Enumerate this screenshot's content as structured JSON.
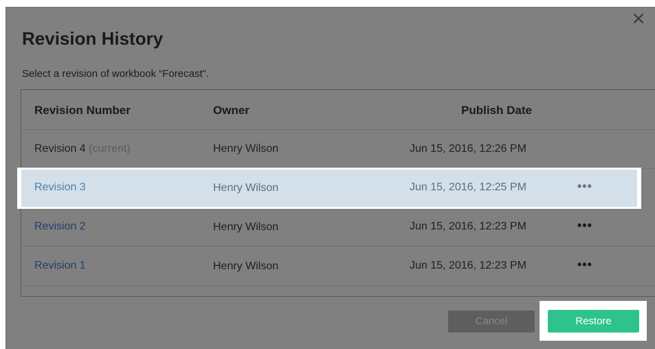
{
  "dialog": {
    "title": "Revision History",
    "subtitle": "Select a revision of workbook “Forecast”.",
    "close_icon": "close-icon",
    "close_glyph": "×"
  },
  "table": {
    "headers": {
      "revision": "Revision Number",
      "owner": "Owner",
      "date": "Publish Date"
    },
    "rows": [
      {
        "revision": "Revision 4",
        "tag": "(current)",
        "owner": "Henry Wilson",
        "date": "Jun 15, 2016, 12:26 PM",
        "more": ""
      },
      {
        "revision": "Revision 3",
        "tag": "",
        "owner": "Henry Wilson",
        "date": "Jun 15, 2016, 12:25 PM",
        "more": "•••"
      },
      {
        "revision": "Revision 2",
        "tag": "",
        "owner": "Henry Wilson",
        "date": "Jun 15, 2016, 12:23 PM",
        "more": "•••"
      },
      {
        "revision": "Revision 1",
        "tag": "",
        "owner": "Henry Wilson",
        "date": "Jun 15, 2016, 12:23 PM",
        "more": "•••"
      }
    ]
  },
  "buttons": {
    "cancel": "Cancel",
    "restore": "Restore"
  },
  "colors": {
    "overlay": "#808080",
    "selected_row": "#d3e0ea",
    "restore_accent": "#2ec38d"
  }
}
